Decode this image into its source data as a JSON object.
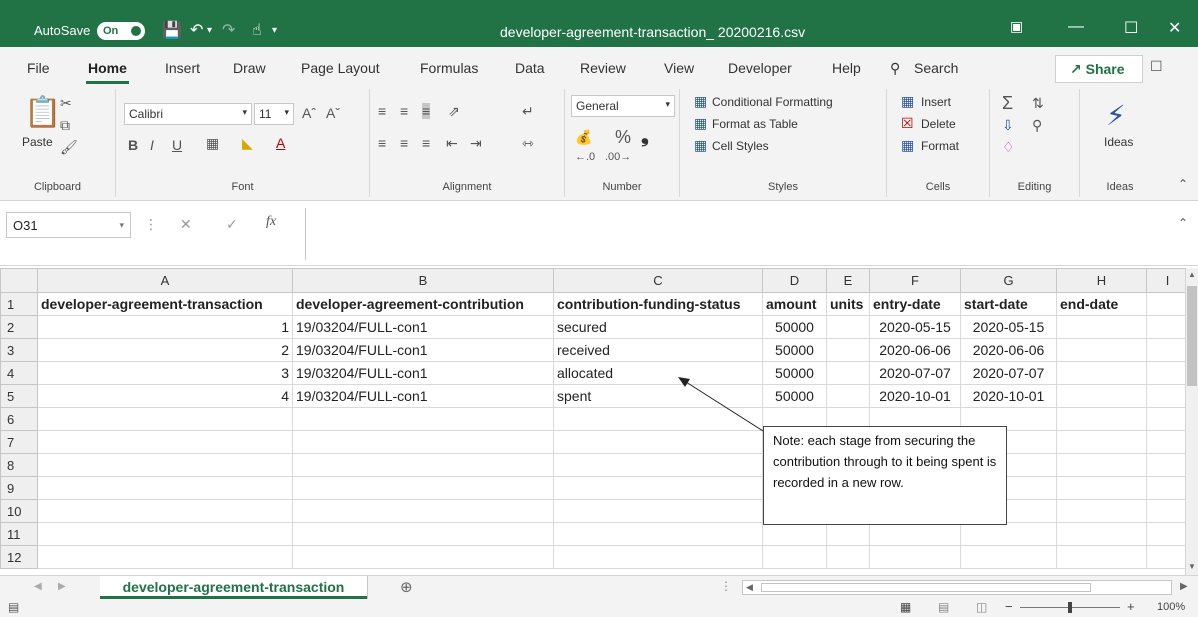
{
  "titlebar": {
    "autosave_label": "AutoSave",
    "autosave_state": "On",
    "doc_title": "developer-agreement-transaction_ 20200216.csv",
    "accent": "#217346"
  },
  "menu": {
    "tabs": [
      "File",
      "Home",
      "Insert",
      "Draw",
      "Page Layout",
      "Formulas",
      "Data",
      "Review",
      "View",
      "Developer",
      "Help"
    ],
    "active_tab": "Home",
    "search": "Search",
    "share": "Share"
  },
  "ribbon": {
    "clipboard": {
      "paste": "Paste",
      "label": "Clipboard"
    },
    "font": {
      "family": "Calibri",
      "size": "11",
      "label": "Font"
    },
    "alignment": {
      "label": "Alignment"
    },
    "number": {
      "format": "General",
      "label": "Number",
      "percent": "%",
      "comma": "❟"
    },
    "styles": {
      "conditional": "Conditional Formatting",
      "table": "Format as Table",
      "cell": "Cell Styles",
      "label": "Styles"
    },
    "cells": {
      "insert": "Insert",
      "delete": "Delete",
      "format": "Format",
      "label": "Cells"
    },
    "editing": {
      "label": "Editing"
    },
    "ideas": {
      "button": "Ideas",
      "label": "Ideas"
    }
  },
  "formula_bar": {
    "name_box": "O31",
    "fx": "fx",
    "value": ""
  },
  "columns": [
    "A",
    "B",
    "C",
    "D",
    "E",
    "F",
    "G",
    "H",
    "I"
  ],
  "rows": [
    [
      "developer-agreement-transaction",
      "developer-agreement-contribution",
      "contribution-funding-status",
      "amount",
      "units",
      "entry-date",
      "start-date",
      "end-date",
      ""
    ],
    [
      "1",
      "19/03204/FULL-con1",
      "secured",
      "50000",
      "",
      "2020-05-15",
      "2020-05-15",
      "",
      ""
    ],
    [
      "2",
      "19/03204/FULL-con1",
      "received",
      "50000",
      "",
      "2020-06-06",
      "2020-06-06",
      "",
      ""
    ],
    [
      "3",
      "19/03204/FULL-con1",
      "allocated",
      "50000",
      "",
      "2020-07-07",
      "2020-07-07",
      "",
      ""
    ],
    [
      "4",
      "19/03204/FULL-con1",
      "spent",
      "50000",
      "",
      "2020-10-01",
      "2020-10-01",
      "",
      ""
    ],
    [
      "",
      "",
      "",
      "",
      "",
      "",
      "",
      "",
      ""
    ],
    [
      "",
      "",
      "",
      "",
      "",
      "",
      "",
      "",
      ""
    ],
    [
      "",
      "",
      "",
      "",
      "",
      "",
      "",
      "",
      ""
    ],
    [
      "",
      "",
      "",
      "",
      "",
      "",
      "",
      "",
      ""
    ],
    [
      "",
      "",
      "",
      "",
      "",
      "",
      "",
      "",
      ""
    ],
    [
      "",
      "",
      "",
      "",
      "",
      "",
      "",
      "",
      ""
    ],
    [
      "",
      "",
      "",
      "",
      "",
      "",
      "",
      "",
      ""
    ]
  ],
  "note": "Note: each stage from securing the contribution through to it being spent is recorded in a new row.",
  "sheet_tab": "developer-agreement-transaction",
  "zoom": "100%"
}
